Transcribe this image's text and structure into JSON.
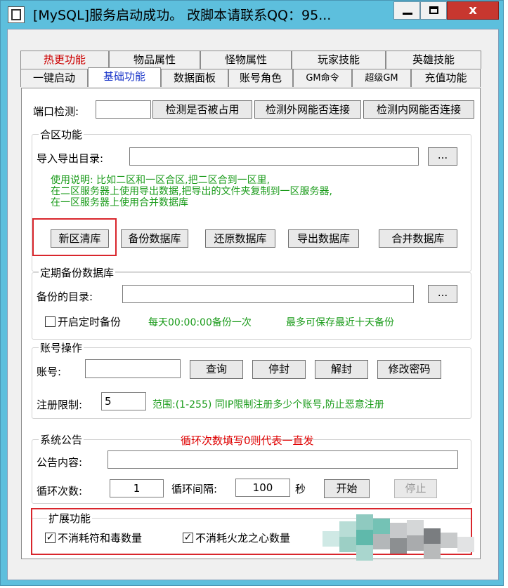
{
  "window": {
    "title": "[MySQL]服务启动成功。 改脚本请联系QQ：95...",
    "minimize_glyph": "",
    "maximize_glyph": "",
    "close_glyph": "x"
  },
  "tabs_row1": [
    {
      "label": "热更功能",
      "hot": true
    },
    {
      "label": "物品属性"
    },
    {
      "label": "怪物属性"
    },
    {
      "label": "玩家技能"
    },
    {
      "label": "英雄技能"
    }
  ],
  "tabs_row2": [
    {
      "label": "一键启动"
    },
    {
      "label": "基础功能",
      "active": true
    },
    {
      "label": "数据面板"
    },
    {
      "label": "账号角色"
    },
    {
      "label": "GM命令"
    },
    {
      "label": "超级GM"
    },
    {
      "label": "充值功能"
    }
  ],
  "port": {
    "label": "端口检测:",
    "value": "",
    "btn_occupied": "检测是否被占用",
    "btn_external": "检测外网能否连接",
    "btn_internal": "检测内网能否连接"
  },
  "merge": {
    "title": "合区功能",
    "dir_label": "导入导出目录:",
    "dir_value": "",
    "browse": "...",
    "instructions": [
      "使用说明: 比如二区和一区合区,把二区合到一区里,",
      "在二区服务器上使用导出数据,把导出的文件夹复制到一区服务器,",
      "在一区服务器上使用合并数据库"
    ],
    "btn_clear": "新区清库",
    "btn_backup": "备份数据库",
    "btn_restore": "还原数据库",
    "btn_export": "导出数据库",
    "btn_merge": "合并数据库"
  },
  "backup": {
    "title": "定期备份数据库",
    "dir_label": "备份的目录:",
    "dir_value": "",
    "browse": "...",
    "timer_label": "开启定时备份",
    "timer_checked": false,
    "info1": "每天00:00:00备份一次",
    "info2": "最多可保存最近十天备份"
  },
  "account": {
    "title": "账号操作",
    "account_label": "账号:",
    "account_value": "",
    "btn_query": "查询",
    "btn_ban": "停封",
    "btn_unban": "解封",
    "btn_password": "修改密码",
    "limit_label": "注册限制:",
    "limit_value": "5",
    "limit_info": "范围:(1-255) 同IP限制注册多少个账号,防止恶意注册"
  },
  "notice": {
    "title": "系统公告",
    "hint": "循环次数填写0则代表一直发",
    "content_label": "公告内容:",
    "content_value": "",
    "count_label": "循环次数:",
    "count_value": "1",
    "interval_label": "循环间隔:",
    "interval_value": "100",
    "unit": "秒",
    "btn_start": "开始",
    "btn_stop": "停止"
  },
  "ext": {
    "title": "扩展功能",
    "opt1": "不消耗符和毒数量",
    "opt1_checked": true,
    "opt2": "不消耗火龙之心数量",
    "opt2_checked": true
  },
  "colors": {
    "frame": "#5dbfdd",
    "close": "#c7372f",
    "highlight": "#d9262c",
    "green_text": "#1a9b1a",
    "active_tab": "#1a36c9"
  }
}
